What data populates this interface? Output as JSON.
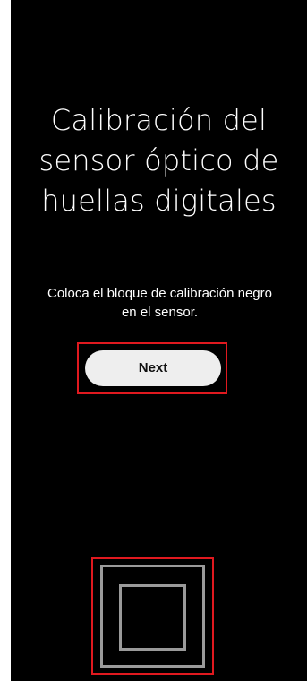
{
  "screen": {
    "title": "Calibración del sensor óptico de huellas digitales",
    "instruction_line1": "Coloca el bloque de calibración negro",
    "instruction_line2": "en el sensor.",
    "next_label": "Next"
  },
  "colors": {
    "background": "#000000",
    "text": "#ffffff",
    "button_fill": "#eeeeee",
    "button_text": "#111111",
    "highlight": "#e0191f",
    "sensor_outline": "#9a9a9a"
  },
  "icons": {
    "sensor_target": "fingerprint-sensor-target-icon"
  }
}
